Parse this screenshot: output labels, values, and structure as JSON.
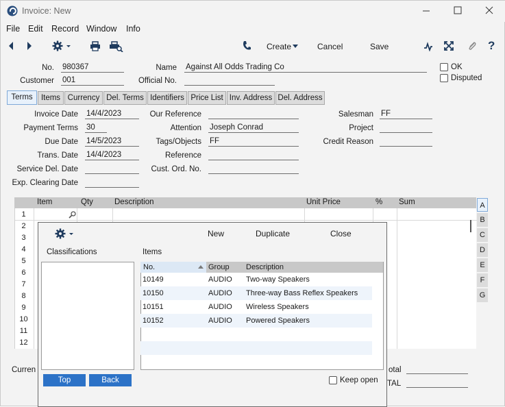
{
  "window": {
    "title": "Invoice: New"
  },
  "menu": [
    "File",
    "Edit",
    "Record",
    "Window",
    "Info"
  ],
  "toolbar": {
    "create": "Create",
    "cancel": "Cancel",
    "save": "Save"
  },
  "header": {
    "no_label": "No.",
    "no_value": "980367",
    "customer_label": "Customer",
    "customer_value": "001",
    "name_label": "Name",
    "name_value": "Against All Odds Trading Co",
    "official_label": "Official No.",
    "official_value": "",
    "ok_label": "OK",
    "disputed_label": "Disputed"
  },
  "tabs": [
    "Terms",
    "Items",
    "Currency",
    "Del. Terms",
    "Identifiers",
    "Price List",
    "Inv. Address",
    "Del. Address"
  ],
  "terms": {
    "invoice_date_label": "Invoice Date",
    "invoice_date": "14/4/2023",
    "payment_terms_label": "Payment Terms",
    "payment_terms": "30",
    "due_date_label": "Due Date",
    "due_date": "14/5/2023",
    "trans_date_label": "Trans. Date",
    "trans_date": "14/4/2023",
    "service_del_label": "Service Del. Date",
    "service_del": "",
    "exp_clearing_label": "Exp. Clearing Date",
    "exp_clearing": "",
    "our_ref_label": "Our Reference",
    "our_ref": "",
    "attention_label": "Attention",
    "attention": "Joseph Conrad",
    "tags_label": "Tags/Objects",
    "tags": "FF",
    "reference_label": "Reference",
    "reference": "",
    "cust_ord_label": "Cust. Ord. No.",
    "cust_ord": "",
    "salesman_label": "Salesman",
    "salesman": "FF",
    "project_label": "Project",
    "project": "",
    "credit_reason_label": "Credit Reason",
    "credit_reason": ""
  },
  "grid": {
    "headers": [
      "Item",
      "Qty",
      "Description",
      "Unit Price",
      "%",
      "Sum"
    ],
    "rows": [
      "1",
      "2",
      "3",
      "4",
      "5",
      "6",
      "7",
      "8",
      "9",
      "10",
      "11",
      "12"
    ],
    "side_buttons": [
      "A",
      "B",
      "C",
      "D",
      "E",
      "F",
      "G"
    ]
  },
  "footer": {
    "currency_label": "Curren",
    "total_label": "otal",
    "total2_label": "TAL"
  },
  "popup": {
    "new": "New",
    "duplicate": "Duplicate",
    "close": "Close",
    "classifications_label": "Classifications",
    "items_label": "Items",
    "columns": [
      "No.",
      "Group",
      "Description"
    ],
    "items": [
      {
        "no": "10149",
        "group": "AUDIO",
        "desc": "Two-way Speakers"
      },
      {
        "no": "10150",
        "group": "AUDIO",
        "desc": "Three-way Bass Reflex Speakers"
      },
      {
        "no": "10151",
        "group": "AUDIO",
        "desc": "Wireless Speakers"
      },
      {
        "no": "10152",
        "group": "AUDIO",
        "desc": "Powered Speakers"
      }
    ],
    "top": "Top",
    "back": "Back",
    "keep_open": "Keep open"
  }
}
